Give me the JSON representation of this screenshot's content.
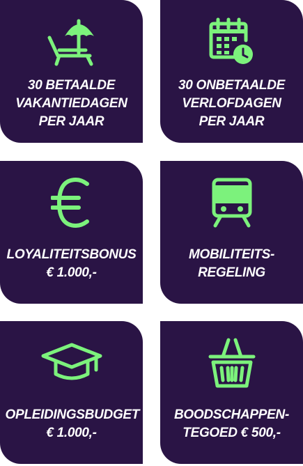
{
  "accent_color": "#7cf27c",
  "card_color": "#2a1445",
  "benefits": [
    {
      "icon": "beach-umbrella-icon",
      "lines": [
        "30 BETAALDE",
        "VAKANTIEDAGEN",
        "PER JAAR"
      ]
    },
    {
      "icon": "calendar-clock-icon",
      "lines": [
        "30 ONBETAALDE",
        "VERLOFDAGEN",
        "PER JAAR"
      ]
    },
    {
      "icon": "euro-icon",
      "lines": [
        "LOYALITEITSBONUS",
        "€ 1.000,-"
      ]
    },
    {
      "icon": "train-icon",
      "lines": [
        "MOBILITEITS-",
        "REGELING"
      ]
    },
    {
      "icon": "graduation-cap-icon",
      "lines": [
        "OPLEIDINGSBUDGET",
        "€ 1.000,-"
      ]
    },
    {
      "icon": "shopping-basket-icon",
      "lines": [
        "BOODSCHAPPEN-",
        "TEGOED € 500,-"
      ]
    }
  ]
}
